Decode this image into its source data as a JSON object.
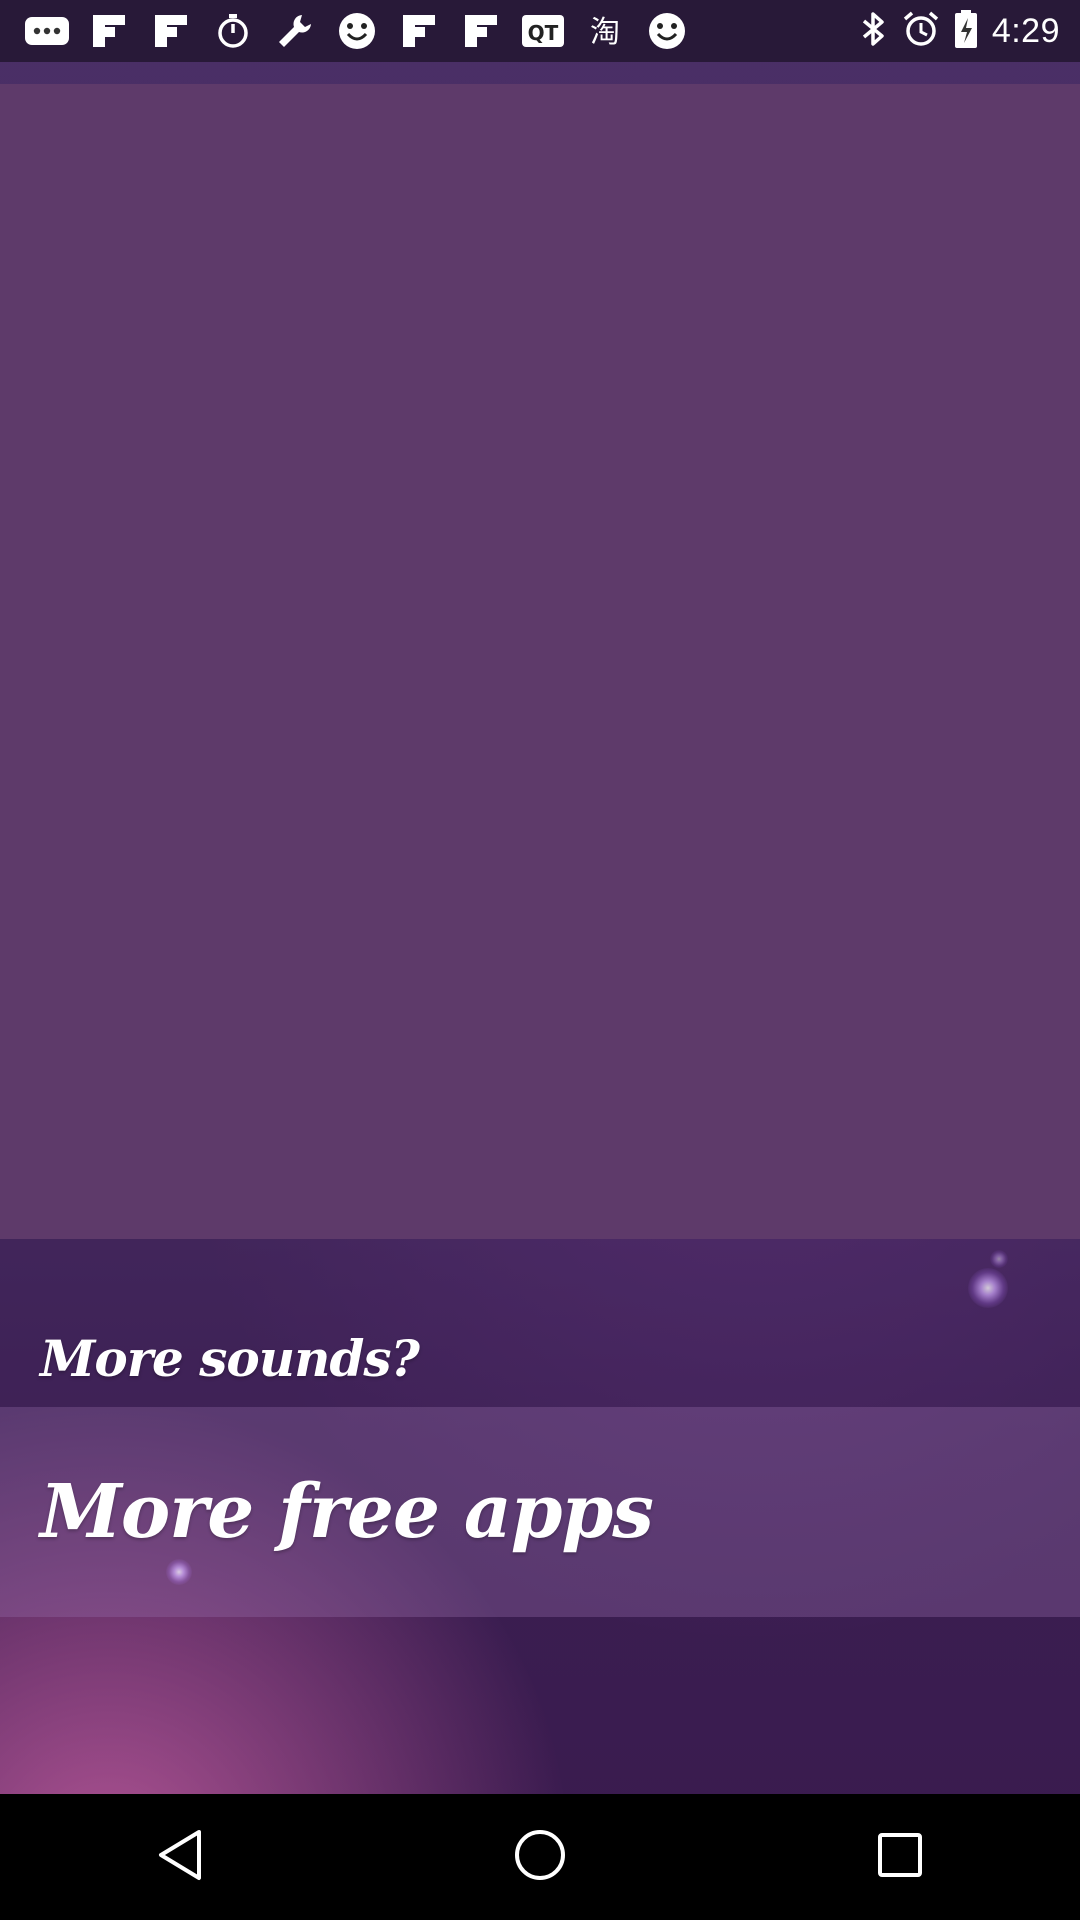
{
  "status_bar": {
    "time": "4:29",
    "left_icons": [
      "more-dots-icon",
      "flipboard-icon",
      "flipboard-icon",
      "timer-icon",
      "wrench-icon",
      "smiley-icon",
      "flipboard-icon",
      "flipboard-icon",
      "qt-icon",
      "chinese-char-icon",
      "smiley-icon"
    ],
    "right_icons": [
      "bluetooth-icon",
      "alarm-icon",
      "battery-charging-icon"
    ]
  },
  "menu": {
    "more_sounds": "More sounds?",
    "more_free_apps": "More free apps"
  },
  "nav": {
    "back": "back-icon",
    "home": "home-icon",
    "recents": "recents-icon"
  },
  "colors": {
    "panel": "#5e3a6a",
    "background_top": "#4a2f66",
    "background_bottom": "#3a1a4e",
    "text": "#ffffff"
  }
}
